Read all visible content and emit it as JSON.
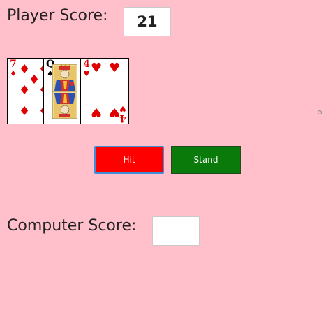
{
  "player": {
    "label": "Player Score:",
    "score": "21"
  },
  "computer": {
    "label": "Computer Score:",
    "score": ""
  },
  "cards": [
    {
      "rank": "7",
      "suit": "♦",
      "suit_name": "diamonds",
      "color": "#e00000"
    },
    {
      "rank": "Q",
      "suit": "♠",
      "suit_name": "spades",
      "color": "#000000"
    },
    {
      "rank": "4",
      "suit": "♥",
      "suit_name": "hearts",
      "color": "#e00000"
    }
  ],
  "buttons": {
    "hit_label": "Hit",
    "stand_label": "Stand"
  },
  "colors": {
    "background": "#ffc0cb",
    "hit": "#ff0000",
    "stand": "#0a7a0a"
  }
}
